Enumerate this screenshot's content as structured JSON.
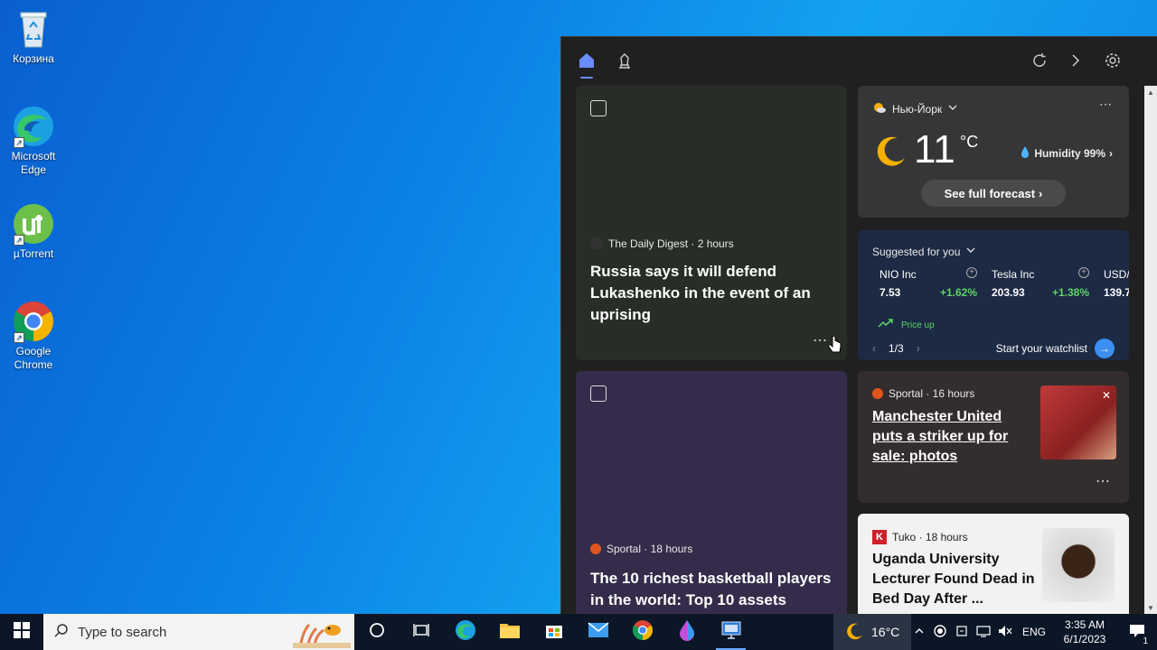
{
  "desktop": {
    "icons": [
      {
        "label": "Корзина"
      },
      {
        "label": "Microsoft Edge"
      },
      {
        "label": "µTorrent"
      },
      {
        "label": "Google Chrome"
      }
    ]
  },
  "widgets": {
    "news1": {
      "source": "The Daily Digest · 2 hours",
      "headline": "Russia says it will defend Lukashenko in the event of an uprising"
    },
    "news2": {
      "source": "Sportal · 18 hours",
      "headline": "The 10 richest basketball players in the world: Top 10 assets"
    },
    "news3": {
      "source": "Sportal · 16 hours",
      "headline": "Manchester United puts a striker up for sale: photos"
    },
    "news4": {
      "source": "Tuko · 18 hours",
      "headline": "Uganda University Lecturer Found Dead in Bed Day After ..."
    },
    "weather": {
      "location": "Нью-Йорк",
      "temperature": "11",
      "unit": "°C",
      "humidity": "Humidity 99%",
      "forecast_button": "See full forecast"
    },
    "stocks": {
      "title": "Suggested for you",
      "items": [
        {
          "name": "NIO Inc",
          "price": "7.53",
          "change": "+1.62%"
        },
        {
          "name": "Tesla Inc",
          "price": "203.93",
          "change": "+1.38%"
        },
        {
          "name": "USD/",
          "price": "139.7",
          "change": ""
        }
      ],
      "price_up": "Price up",
      "pager": "1/3",
      "watchlist": "Start your watchlist"
    }
  },
  "taskbar": {
    "search_placeholder": "Type to search",
    "weather_temp": "16°C",
    "language": "ENG",
    "time": "3:35 AM",
    "date": "6/1/2023",
    "notification_count": "1"
  }
}
